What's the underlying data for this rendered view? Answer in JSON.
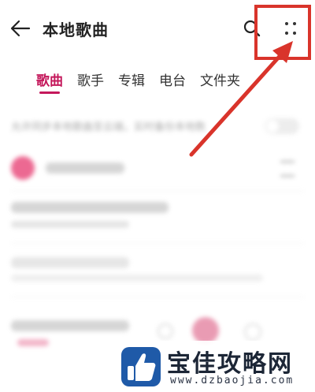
{
  "header": {
    "title": "本地歌曲",
    "back_icon": "arrow-left-icon",
    "search_icon": "search-icon",
    "more_icon": "four-dots-more-icon"
  },
  "tabs": [
    {
      "label": "歌曲",
      "active": true
    },
    {
      "label": "歌手",
      "active": false
    },
    {
      "label": "专辑",
      "active": false
    },
    {
      "label": "电台",
      "active": false
    },
    {
      "label": "文件夹",
      "active": false
    }
  ],
  "sync_setting": {
    "text": "允许同步本地歌曲至云端，实时备份本地数"
  },
  "annotation": {
    "highlight_color": "#d9342b"
  },
  "watermark": {
    "title": "宝佳攻略网",
    "url": "www.dzbaojia.com"
  },
  "colors": {
    "accent": "#c4185b"
  }
}
